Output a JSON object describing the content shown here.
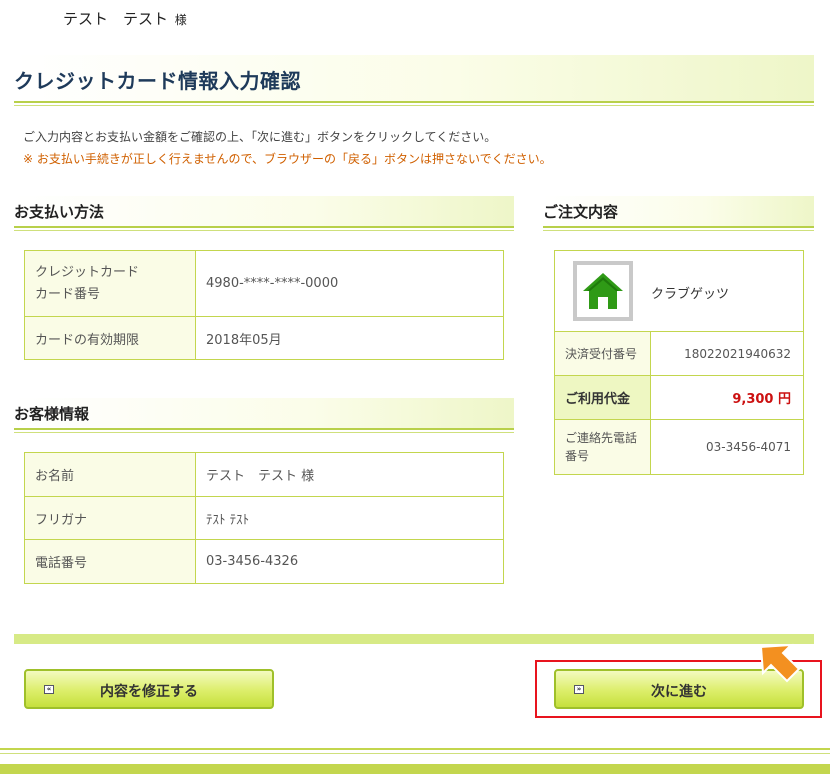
{
  "header": {
    "user_name": "テスト　テスト",
    "honorific": "様"
  },
  "page_title": "クレジットカード情報入力確認",
  "intro_text": "ご入力内容とお支払い金額をご確認の上、「次に進む」ボタンをクリックしてください。",
  "warning_text": "※ お支払い手続きが正しく行えませんので、ブラウザーの「戻る」ボタンは押さないでください。",
  "payment": {
    "heading": "お支払い方法",
    "card_label_line1": "クレジットカード",
    "card_label_line2": "カード番号",
    "card_number": "4980-****-****-0000",
    "expiry_label": "カードの有効期限",
    "expiry_value": "2018年05月"
  },
  "customer": {
    "heading": "お客様情報",
    "name_label": "お名前",
    "name_value": "テスト　テスト 様",
    "kana_label": "フリガナ",
    "kana_value": "ﾃｽﾄ ﾃｽﾄ",
    "phone_label": "電話番号",
    "phone_value": "03-3456-4326"
  },
  "order": {
    "heading": "ご注文内容",
    "product_name": "クラブゲッツ",
    "product_icon": "house-icon",
    "receipt_label": "決済受付番号",
    "receipt_value": "18022021940632",
    "total_label": "ご利用代金",
    "total_value": "9,300 円",
    "contact_label": "ご連絡先電話番号",
    "contact_value": "03-3456-4071"
  },
  "buttons": {
    "back_label": "内容を修正する",
    "back_icon": "arrow-left-icon",
    "next_label": "次に進む",
    "next_icon": "arrow-right-icon"
  },
  "colors": {
    "accent_green": "#c3d64e",
    "title_navy": "#1e3a5a",
    "warning_orange": "#d06000",
    "price_red": "#cc1111",
    "highlight_red": "#e8141e",
    "pointer_orange": "#f39020"
  }
}
